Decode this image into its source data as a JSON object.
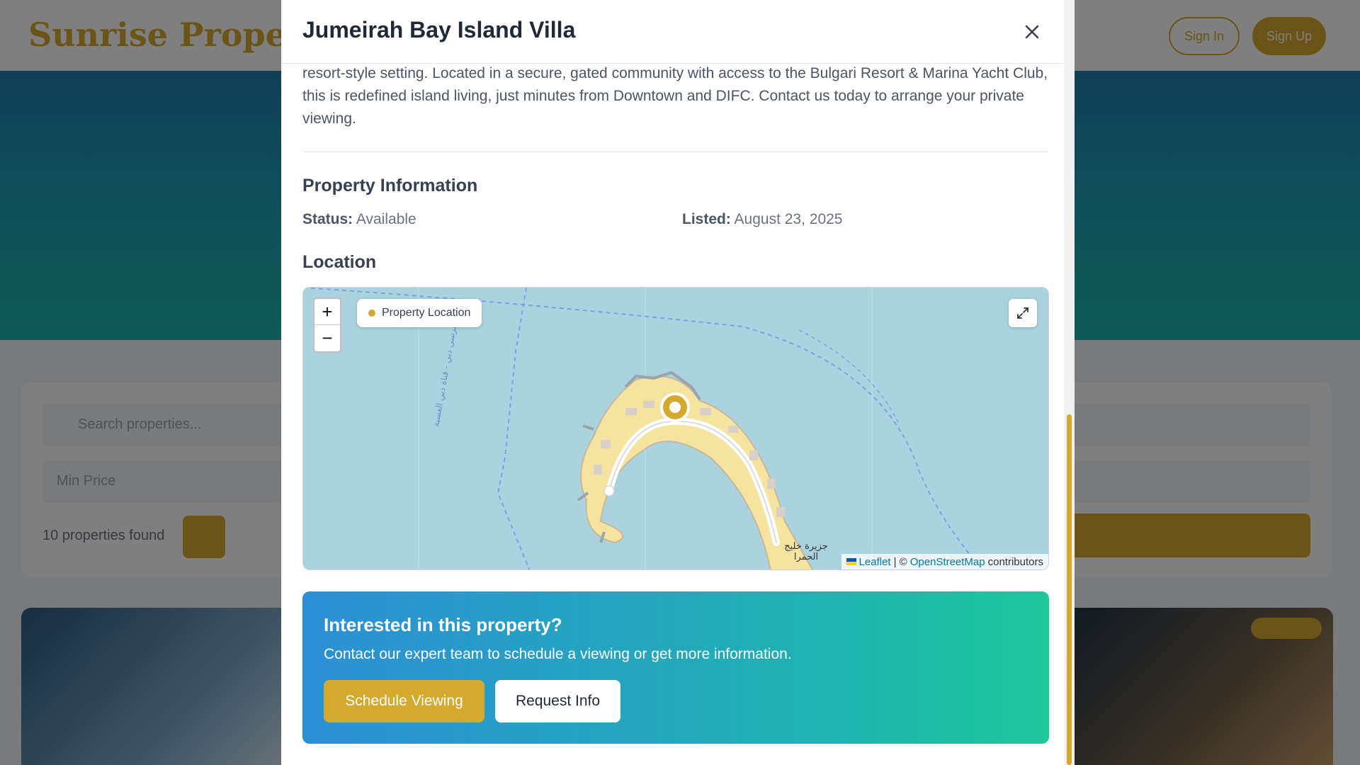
{
  "background_page": {
    "logo": "Sunrise Property",
    "sign_in": "Sign In",
    "sign_up": "Sign Up",
    "search_placeholder": "Search properties...",
    "min_price": "Min Price",
    "properties_found": "10 properties found"
  },
  "modal": {
    "title": "Jumeirah Bay Island Villa",
    "close_icon": "close-icon",
    "description": "resort-style setting. Located in a secure, gated community with access to the Bulgari Resort & Marina Yacht Club, this is redefined island living, just minutes from Downtown and DIFC. Contact us today to arrange your private viewing.",
    "property_info": {
      "heading": "Property Information",
      "status_label": "Status:",
      "status_value": "Available",
      "listed_label": "Listed:",
      "listed_value": "August 23, 2025"
    },
    "location": {
      "heading": "Location",
      "legend_label": "Property Location",
      "zoom_in": "+",
      "zoom_out": "−",
      "fullscreen_icon": "expand-icon",
      "map_label_channel": "مرسى دبي - قناة دبي العسبة",
      "map_label_island": "جزيرة خليج الحمرا",
      "attribution": {
        "leaflet": "Leaflet",
        "separator": "| ©",
        "osm": "OpenStreetMap",
        "contributors": "contributors"
      }
    },
    "cta": {
      "title": "Interested in this property?",
      "text": "Contact our expert team to schedule a viewing or get more information.",
      "schedule_button": "Schedule Viewing",
      "info_button": "Request Info"
    },
    "colors": {
      "accent": "#d4a92e",
      "water": "#aad3df",
      "sand": "#f5e3a0"
    }
  }
}
